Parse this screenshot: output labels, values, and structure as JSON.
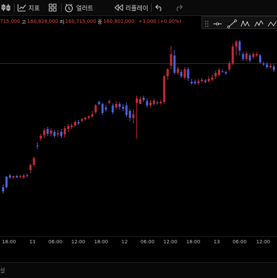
{
  "toolbar": {
    "indicators_label": "지표",
    "alert_label": "얼러트",
    "replay_label": "리플레이"
  },
  "ohlc": {
    "open_value": "715,000",
    "high_label": "고",
    "high_value": "160,828,000",
    "low_label": "저",
    "low_value": "160,715,000",
    "close_label": "종",
    "close_value": "160,801,000",
    "change": "+1,000 (+0.00%)"
  },
  "x_axis": {
    "labels": [
      "18:00",
      "11",
      "06:00",
      "12:00",
      "18:00",
      "12",
      "06:00",
      "12:00",
      "18:00",
      "13",
      "06:00",
      "12:00"
    ]
  },
  "bottom": {
    "text": "설"
  },
  "colors": {
    "up": "#c62b3c",
    "down": "#4b63e0",
    "background": "#000000"
  },
  "chart_data": {
    "type": "candlestick",
    "x_ticks": [
      "18:00",
      "11",
      "06:00",
      "12:00",
      "18:00",
      "12",
      "06:00",
      "12:00",
      "18:00",
      "13",
      "06:00",
      "12:00"
    ],
    "candles": [
      [
        270,
        276,
        266,
        279
      ],
      [
        255,
        270,
        254,
        272
      ],
      [
        253,
        256,
        251,
        258
      ],
      [
        256,
        254,
        253,
        258
      ],
      [
        254,
        256,
        252,
        257
      ],
      [
        255,
        254,
        252,
        257
      ],
      [
        256,
        253,
        251,
        258
      ],
      [
        253,
        254,
        250,
        256
      ],
      [
        245,
        238,
        236,
        250
      ],
      [
        238,
        228,
        226,
        241
      ],
      [
        210,
        210,
        205,
        215
      ],
      [
        200,
        196,
        193,
        203
      ],
      [
        195,
        188,
        185,
        199
      ],
      [
        186,
        193,
        183,
        196
      ],
      [
        193,
        188,
        185,
        197
      ],
      [
        190,
        196,
        187,
        199
      ],
      [
        194,
        192,
        188,
        197
      ],
      [
        190,
        196,
        186,
        199
      ],
      [
        194,
        185,
        182,
        198
      ],
      [
        186,
        182,
        179,
        190
      ],
      [
        183,
        181,
        178,
        186
      ],
      [
        181,
        176,
        174,
        183
      ],
      [
        176,
        178,
        173,
        180
      ],
      [
        174,
        172,
        170,
        176
      ],
      [
        172,
        170,
        168,
        174
      ],
      [
        170,
        168,
        166,
        172
      ],
      [
        168,
        165,
        160,
        170
      ],
      [
        162,
        152,
        150,
        164
      ],
      [
        147,
        150,
        145,
        152
      ],
      [
        150,
        163,
        148,
        166
      ],
      [
        155,
        158,
        151,
        161
      ],
      [
        148,
        146,
        143,
        150
      ],
      [
        152,
        162,
        149,
        165
      ],
      [
        155,
        150,
        146,
        158
      ],
      [
        150,
        154,
        147,
        158
      ],
      [
        154,
        157,
        150,
        160
      ],
      [
        152,
        166,
        148,
        169
      ],
      [
        160,
        170,
        157,
        175
      ],
      [
        170,
        165,
        158,
        178
      ],
      [
        148,
        142,
        138,
        200
      ],
      [
        150,
        143,
        139,
        148
      ],
      [
        141,
        144,
        138,
        147
      ],
      [
        146,
        152,
        142,
        155
      ],
      [
        152,
        148,
        144,
        155
      ],
      [
        150,
        145,
        142,
        152
      ],
      [
        148,
        149,
        145,
        151
      ],
      [
        149,
        147,
        144,
        151
      ],
      [
        147,
        110,
        108,
        150
      ],
      [
        110,
        100,
        98,
        115
      ],
      [
        95,
        78,
        66,
        100
      ],
      [
        80,
        105,
        72,
        108
      ],
      [
        105,
        99,
        96,
        108
      ],
      [
        104,
        110,
        100,
        113
      ],
      [
        112,
        100,
        97,
        114
      ],
      [
        100,
        113,
        97,
        117
      ],
      [
        118,
        120,
        114,
        122
      ],
      [
        118,
        120,
        115,
        122
      ],
      [
        120,
        117,
        114,
        122
      ],
      [
        117,
        115,
        112,
        119
      ],
      [
        116,
        118,
        114,
        120
      ],
      [
        117,
        114,
        110,
        119
      ],
      [
        115,
        112,
        108,
        117
      ],
      [
        110,
        105,
        102,
        114
      ],
      [
        108,
        101,
        98,
        110
      ],
      [
        103,
        103,
        100,
        105
      ],
      [
        104,
        106,
        102,
        108
      ],
      [
        100,
        91,
        88,
        103
      ],
      [
        92,
        67,
        63,
        94
      ],
      [
        67,
        60,
        58,
        80
      ],
      [
        60,
        73,
        58,
        80
      ],
      [
        78,
        85,
        75,
        88
      ],
      [
        85,
        77,
        74,
        88
      ],
      [
        80,
        87,
        77,
        90
      ],
      [
        82,
        78,
        75,
        85
      ],
      [
        80,
        78,
        75,
        82
      ],
      [
        80,
        90,
        78,
        92
      ],
      [
        92,
        93,
        89,
        95
      ],
      [
        93,
        97,
        90,
        99
      ],
      [
        97,
        95,
        92,
        99
      ],
      [
        96,
        101,
        93,
        104
      ]
    ],
    "note": "Candles listed left-to-right; values are vertical price positions read off the plot (no price axis is printed)."
  }
}
